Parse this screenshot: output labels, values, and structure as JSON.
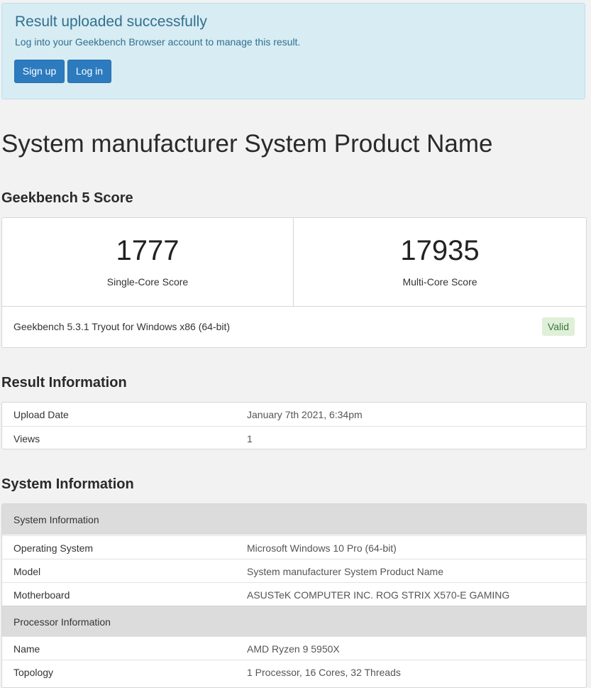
{
  "alert": {
    "title": "Result uploaded successfully",
    "text": "Log into your Geekbench Browser account to manage this result.",
    "signup_label": "Sign up",
    "login_label": "Log in"
  },
  "page_title": "System manufacturer System Product Name",
  "score_section": {
    "title": "Geekbench 5 Score",
    "single_core": {
      "value": "1777",
      "label": "Single-Core Score"
    },
    "multi_core": {
      "value": "17935",
      "label": "Multi-Core Score"
    },
    "version": "Geekbench 5.3.1 Tryout for Windows x86 (64-bit)",
    "status_badge": "Valid"
  },
  "result_info": {
    "title": "Result Information",
    "rows": [
      {
        "key": "Upload Date",
        "value": "January 7th 2021, 6:34pm"
      },
      {
        "key": "Views",
        "value": "1"
      }
    ]
  },
  "system_info": {
    "title": "System Information",
    "groups": [
      {
        "label": "System Information",
        "rows": [
          {
            "key": "Operating System",
            "value": "Microsoft Windows 10 Pro (64-bit)"
          },
          {
            "key": "Model",
            "value": "System manufacturer System Product Name"
          },
          {
            "key": "Motherboard",
            "value": "ASUSTeK COMPUTER INC. ROG STRIX X570-E GAMING"
          }
        ]
      },
      {
        "label": "Processor Information",
        "rows": [
          {
            "key": "Name",
            "value": "AMD Ryzen 9 5950X"
          },
          {
            "key": "Topology",
            "value": "1 Processor, 16 Cores, 32 Threads"
          }
        ]
      }
    ]
  },
  "colors": {
    "alert_bg": "#d7ecf3",
    "alert_text": "#31708f",
    "button_bg": "#2d7bbf",
    "badge_bg": "#dff0d8",
    "badge_text": "#3c763d",
    "group_header_bg": "#dcdcdc"
  }
}
